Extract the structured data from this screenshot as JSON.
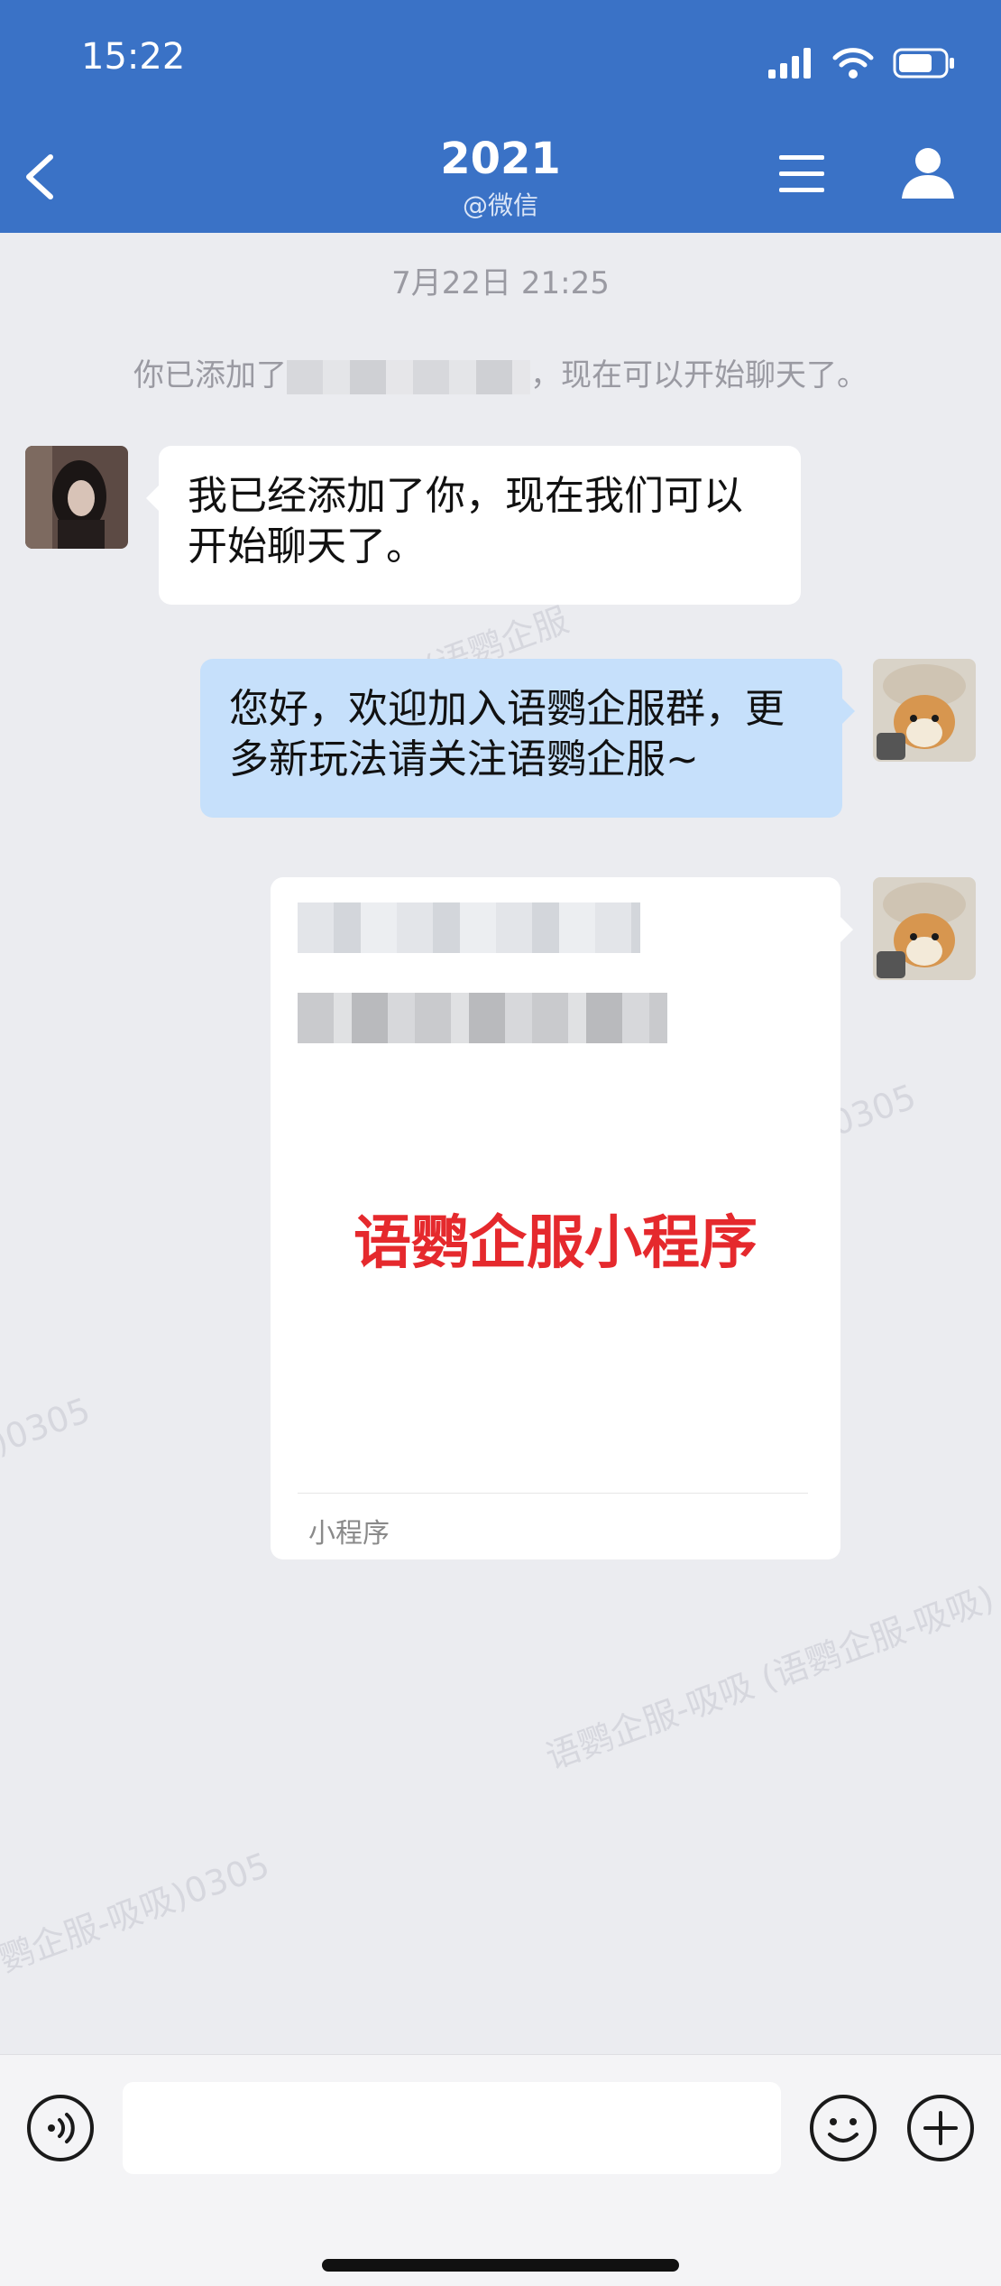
{
  "status_bar": {
    "time": "15:22"
  },
  "header": {
    "title": "2021",
    "subtitle": "@微信"
  },
  "chat": {
    "timestamp": "7月22日 21:25",
    "system_prefix": "你已添加了",
    "system_suffix": "，现在可以开始聊天了。",
    "messages": [
      {
        "direction": "incoming",
        "text": "我已经添加了你，现在我们可以开始聊天了。"
      },
      {
        "direction": "outgoing",
        "text": "您好，欢迎加入语鹦企服群，更多新玩法请关注语鹦企服~"
      }
    ],
    "card": {
      "title": "语鹦企服小程序",
      "type_label": "小程序",
      "title_color": "#e5292d"
    }
  },
  "watermarks": [
    "吸吸 (语鹦企服",
    "0305",
    ")0305",
    "语鹦企服-吸吸 (语鹦企服-吸吸)",
    "鹦企服-吸吸)0305"
  ],
  "colors": {
    "header_bg": "#3a72c6",
    "outgoing_bubble": "#c6e0fb",
    "incoming_bubble": "#ffffff",
    "chat_bg": "#ebecf0"
  },
  "input": {
    "value": "",
    "placeholder": ""
  }
}
